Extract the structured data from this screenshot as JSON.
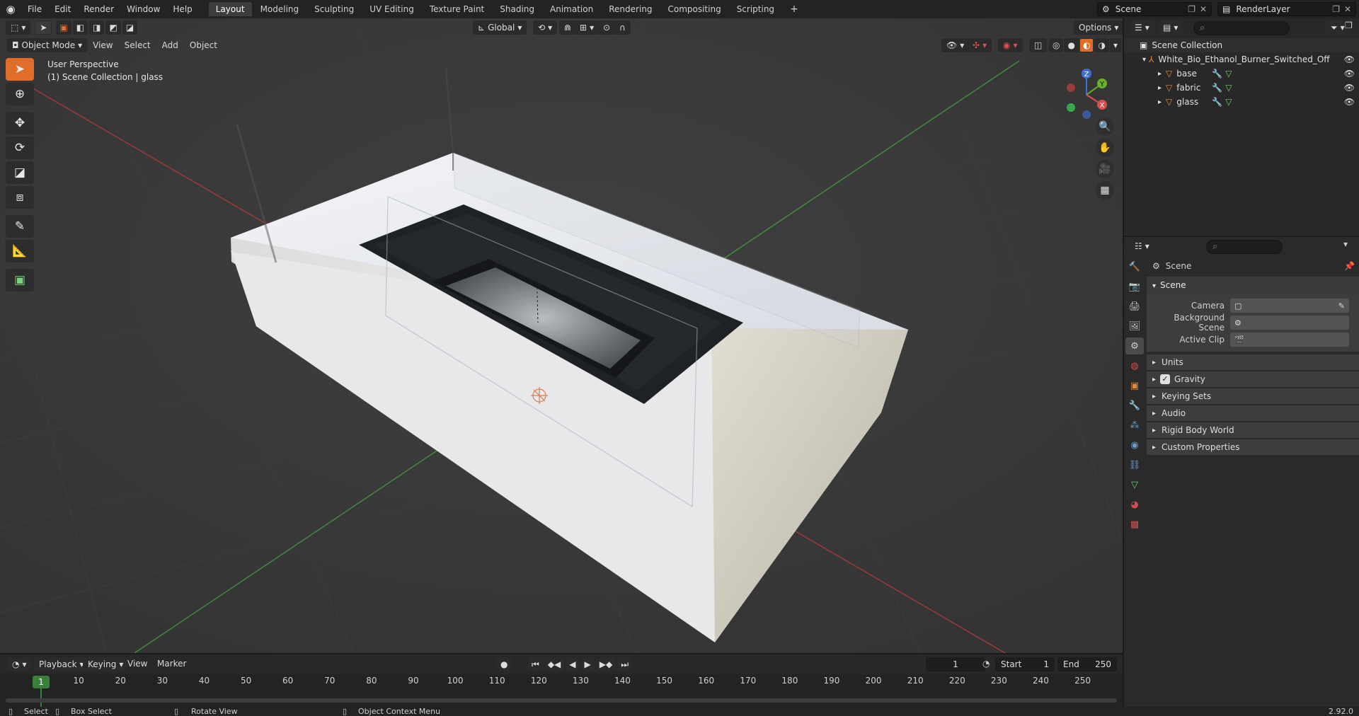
{
  "topbar": {
    "menus": [
      "File",
      "Edit",
      "Render",
      "Window",
      "Help"
    ],
    "workspaces": [
      "Layout",
      "Modeling",
      "Sculpting",
      "UV Editing",
      "Texture Paint",
      "Shading",
      "Animation",
      "Rendering",
      "Compositing",
      "Scripting"
    ],
    "active_workspace": "Layout",
    "add_tab": "+",
    "scene_name": "Scene",
    "view_layer": "RenderLayer"
  },
  "viewport": {
    "mode": "Object Mode",
    "menus": [
      "View",
      "Select",
      "Add",
      "Object"
    ],
    "orientation": "Global",
    "options_label": "Options",
    "perspective_label": "User Perspective",
    "collection_label": "(1) Scene Collection | glass",
    "gizmo_axes": {
      "x": "X",
      "y": "Y",
      "z": "Z"
    }
  },
  "outliner": {
    "root": "Scene Collection",
    "collection": "White_Bio_Ethanol_Burner_Switched_Off",
    "objects": [
      "base",
      "fabric",
      "glass"
    ]
  },
  "properties": {
    "header": "Scene",
    "panel_title": "Scene",
    "fields": [
      {
        "label": "Camera",
        "value": ""
      },
      {
        "label": "Background Scene",
        "value": ""
      },
      {
        "label": "Active Clip",
        "value": ""
      }
    ],
    "subpanels": [
      "Units",
      "Gravity",
      "Keying Sets",
      "Audio",
      "Rigid Body World",
      "Custom Properties"
    ],
    "gravity_checked": true
  },
  "timeline": {
    "menus": [
      "Playback",
      "Keying",
      "View",
      "Marker"
    ],
    "current_frame": "1",
    "start_label": "Start",
    "start_value": "1",
    "end_label": "End",
    "end_value": "250",
    "ticks": [
      "10",
      "20",
      "30",
      "40",
      "50",
      "60",
      "70",
      "80",
      "90",
      "100",
      "110",
      "120",
      "130",
      "140",
      "150",
      "160",
      "170",
      "180",
      "190",
      "200",
      "210",
      "220",
      "230",
      "240",
      "250"
    ],
    "playhead": "1"
  },
  "statusbar": {
    "select": "Select",
    "box_select": "Box Select",
    "rotate": "Rotate View",
    "context_menu": "Object Context Menu",
    "version": "2.92.0"
  }
}
